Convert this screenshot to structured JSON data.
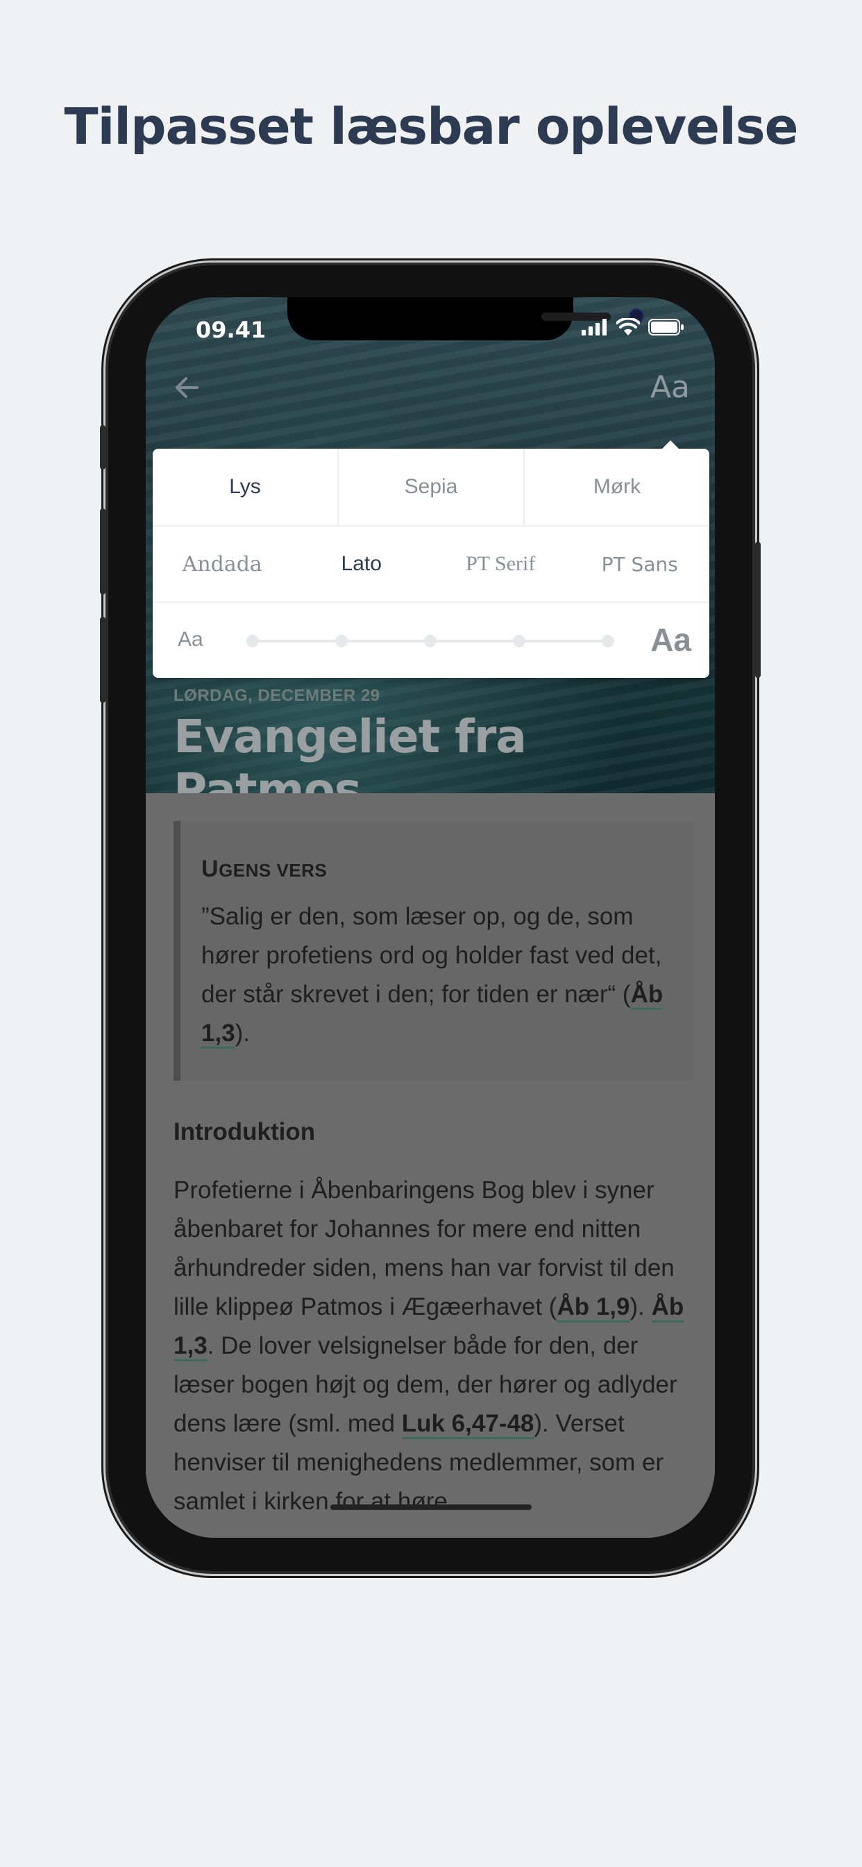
{
  "headline": "Tilpasset læsbar oplevelse",
  "status_bar": {
    "time": "09.41"
  },
  "toolbar": {
    "font_settings_label": "Aa"
  },
  "reader_settings": {
    "themes": [
      "Lys",
      "Sepia",
      "Mørk"
    ],
    "active_theme": "Lys",
    "fonts": [
      "Andada",
      "Lato",
      "PT Serif",
      "PT Sans"
    ],
    "active_font": "Lato",
    "size_small_label": "Aa",
    "size_large_label": "Aa",
    "size_steps": 5
  },
  "lesson": {
    "date": "LØRDAG, DECEMBER 29",
    "title": "Evangeliet fra Patmos"
  },
  "weekly_verse": {
    "heading_first": "U",
    "heading_rest": "GENS VERS",
    "text": "”Salig er den, som læser op, og de, som hører profetiens ord og holder fast ved det, der står skrevet i den; for tiden er nær“ (",
    "ref": "Åb 1,3",
    "text_end": ")."
  },
  "intro": {
    "heading": "Introduktion",
    "part1": "Profetierne i Åbenbaringens Bog blev i syner åbenbaret for Johannes for mere end nitten århundreder siden, mens han var forvist til den lille klippeø Patmos i Ægæerhavet (",
    "ref1": "Åb 1,9",
    "part2": "). ",
    "ref2": "Åb 1,3",
    "part3": ". De lover velsignelser både for den, der læser bogen højt og dem, der hører og adlyder dens lære (sml. med ",
    "ref3": "Luk 6,47-48",
    "part4": "). Verset henviser til menighedens medlemmer, som er samlet i kirken for at høre"
  },
  "colors": {
    "headline": "#2c3a52",
    "active_option": "#2c3a52",
    "inactive_option": "#8a8f96",
    "content_overlay": "#6b6b6b",
    "link_underline": "#3d6b5b"
  }
}
